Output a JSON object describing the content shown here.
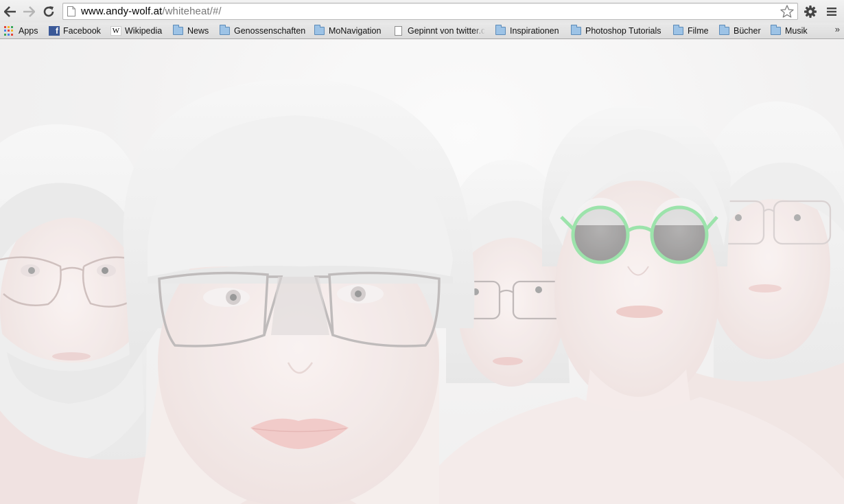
{
  "browser": {
    "url_host": "www.andy-wolf.at",
    "url_path": "/whiteheat/#/",
    "icons": {
      "back": "back-arrow-icon",
      "forward": "forward-arrow-icon",
      "reload": "reload-icon",
      "page": "page-icon",
      "star": "bookmark-star-icon",
      "settings": "settings-gear-icon",
      "menu": "menu-icon"
    }
  },
  "bookmarks": {
    "items": [
      {
        "label": "Apps",
        "icon": "apps-grid-icon"
      },
      {
        "label": "Facebook",
        "icon": "facebook-icon"
      },
      {
        "label": "Wikipedia",
        "icon": "wikipedia-icon"
      },
      {
        "label": "News",
        "icon": "folder-icon"
      },
      {
        "label": "Genossenschaften",
        "icon": "folder-icon"
      },
      {
        "label": "MoNavigation",
        "icon": "folder-icon"
      },
      {
        "label": "Gepinnt von twitter.c",
        "icon": "page-icon"
      },
      {
        "label": "Inspirationen",
        "icon": "folder-icon"
      },
      {
        "label": "Photoshop Tutorials",
        "icon": "folder-icon"
      },
      {
        "label": "Filme",
        "icon": "folder-icon"
      },
      {
        "label": "Bücher",
        "icon": "folder-icon"
      },
      {
        "label": "Musik",
        "icon": "folder-icon"
      }
    ],
    "overflow": "»"
  },
  "content": {
    "image": "campaign photo of five pale models wearing glasses",
    "accent_colors": {
      "mint_frame": "#8fe0a0",
      "skin": "#f3e6e4",
      "hair": "#eeeeee",
      "lips": "#f0c4c2"
    }
  }
}
